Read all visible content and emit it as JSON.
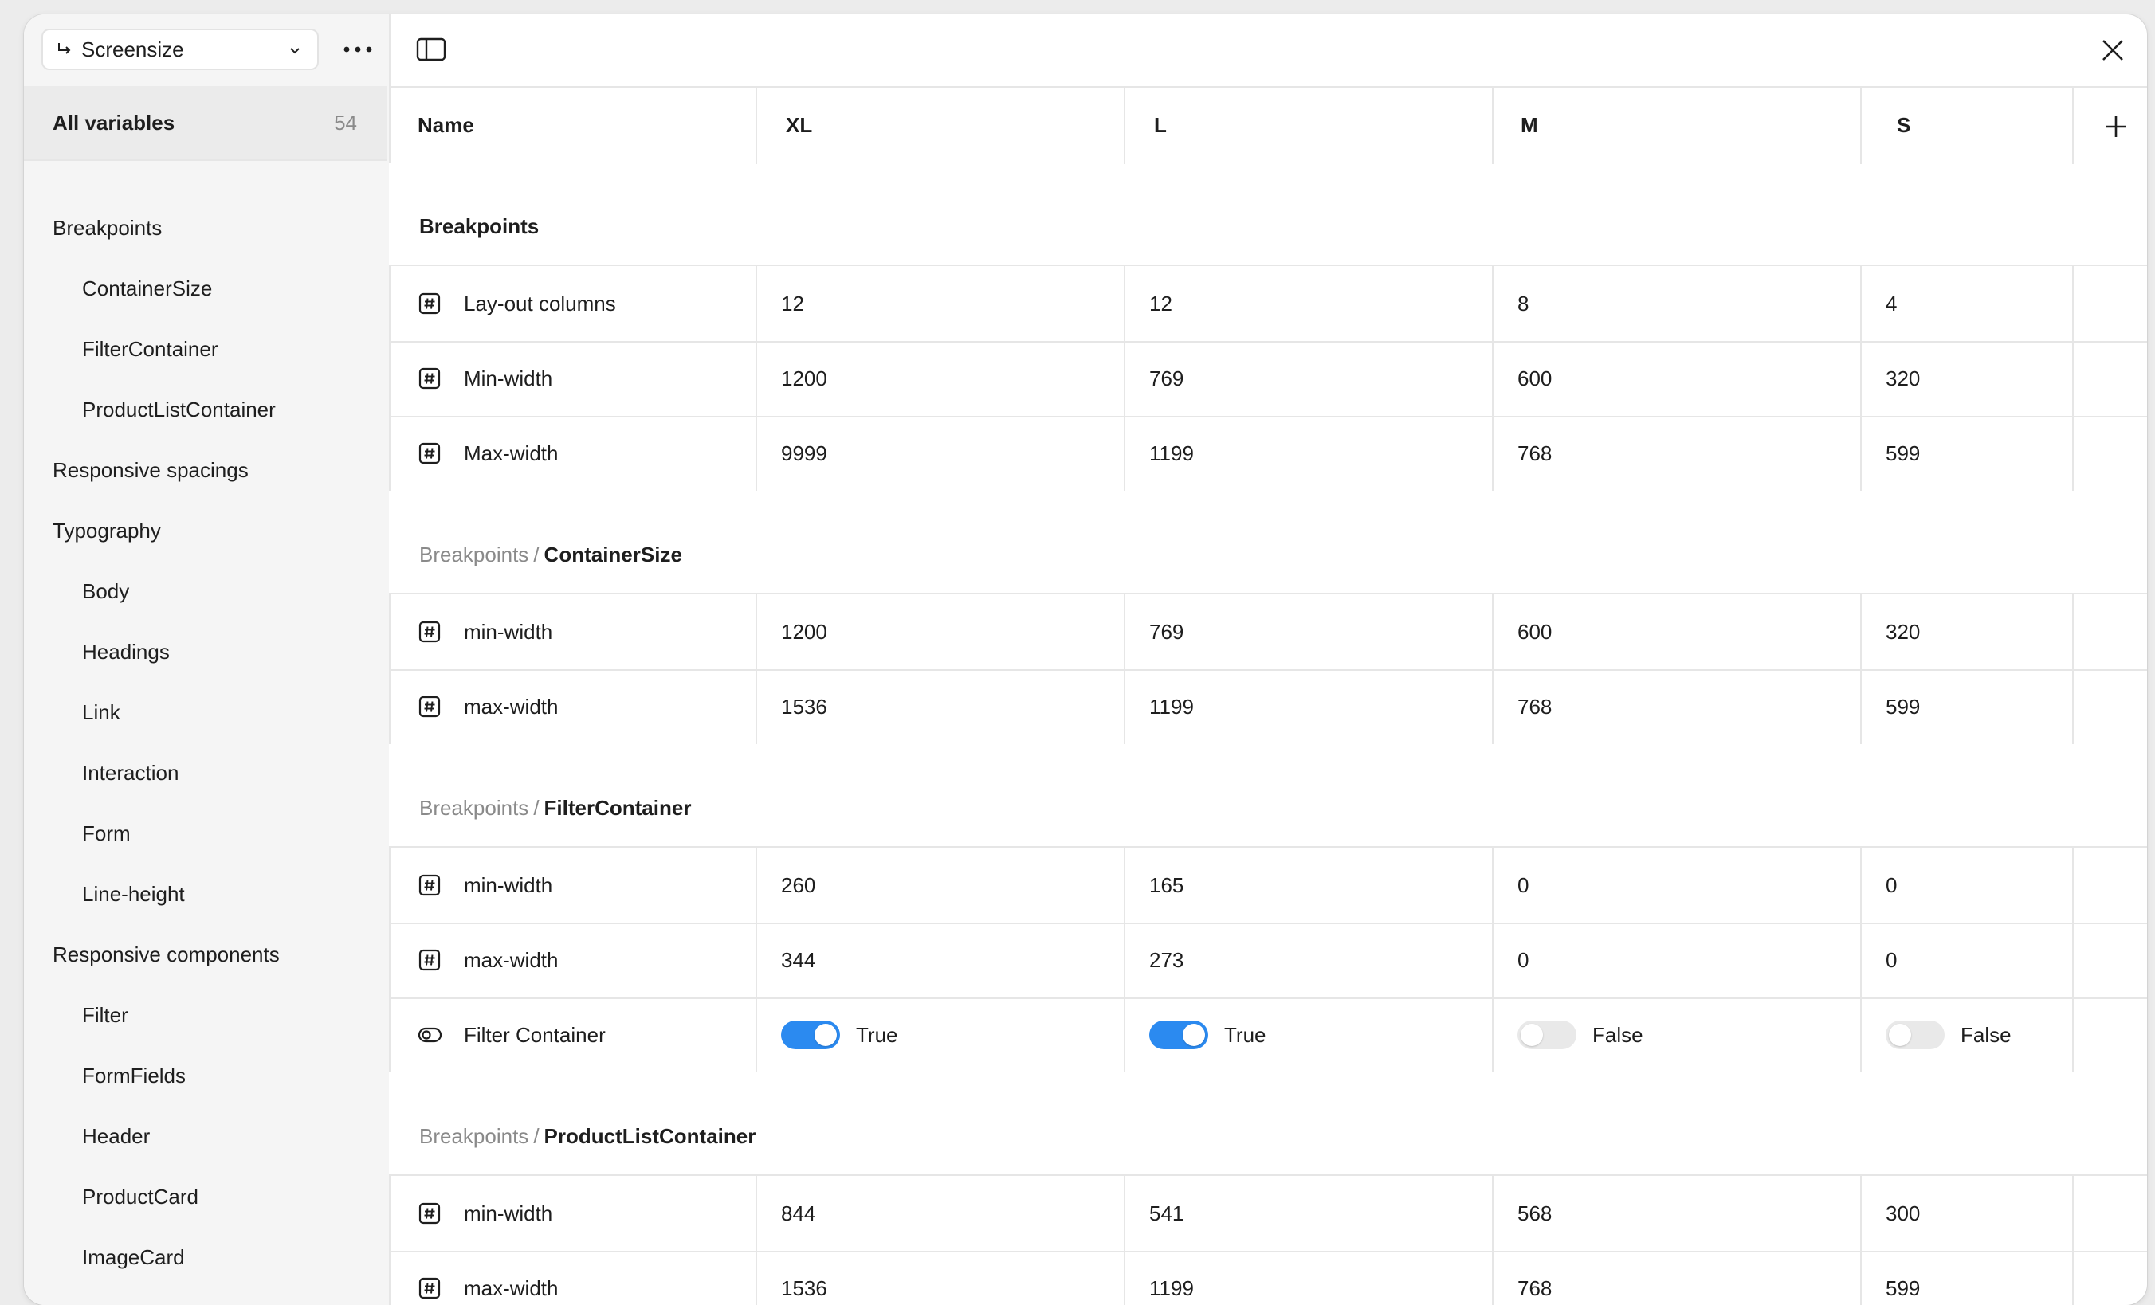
{
  "collection": {
    "name": "Screensize"
  },
  "sidebar": {
    "all_variables_label": "All variables",
    "all_variables_count": "54",
    "groups": [
      {
        "label": "Breakpoints",
        "level": 0
      },
      {
        "label": "ContainerSize",
        "level": 1
      },
      {
        "label": "FilterContainer",
        "level": 1
      },
      {
        "label": "ProductListContainer",
        "level": 1
      },
      {
        "label": "Responsive spacings",
        "level": 0
      },
      {
        "label": "Typography",
        "level": 0
      },
      {
        "label": "Body",
        "level": 1
      },
      {
        "label": "Headings",
        "level": 1
      },
      {
        "label": "Link",
        "level": 1
      },
      {
        "label": "Interaction",
        "level": 1
      },
      {
        "label": "Form",
        "level": 1
      },
      {
        "label": "Line-height",
        "level": 1
      },
      {
        "label": "Responsive components",
        "level": 0
      },
      {
        "label": "Filter",
        "level": 1
      },
      {
        "label": "FormFields",
        "level": 1
      },
      {
        "label": "Header",
        "level": 1
      },
      {
        "label": "ProductCard",
        "level": 1
      },
      {
        "label": "ImageCard",
        "level": 1
      }
    ]
  },
  "table": {
    "columns": [
      "Name",
      "XL",
      "L",
      "M",
      "S"
    ],
    "sections": [
      {
        "crumb": "",
        "leaf": "Breakpoints",
        "rows": [
          {
            "type": "number",
            "name": "Lay-out columns",
            "values": [
              "12",
              "12",
              "8",
              "4"
            ]
          },
          {
            "type": "number",
            "name": "Min-width",
            "values": [
              "1200",
              "769",
              "600",
              "320"
            ]
          },
          {
            "type": "number",
            "name": "Max-width",
            "values": [
              "9999",
              "1199",
              "768",
              "599"
            ]
          }
        ]
      },
      {
        "crumb": "Breakpoints",
        "leaf": "ContainerSize",
        "rows": [
          {
            "type": "number",
            "name": "min-width",
            "values": [
              "1200",
              "769",
              "600",
              "320"
            ]
          },
          {
            "type": "number",
            "name": "max-width",
            "values": [
              "1536",
              "1199",
              "768",
              "599"
            ]
          }
        ]
      },
      {
        "crumb": "Breakpoints",
        "leaf": "FilterContainer",
        "rows": [
          {
            "type": "number",
            "name": "min-width",
            "values": [
              "260",
              "165",
              "0",
              "0"
            ]
          },
          {
            "type": "number",
            "name": "max-width",
            "values": [
              "344",
              "273",
              "0",
              "0"
            ]
          },
          {
            "type": "boolean",
            "name": "Filter Container",
            "values": [
              "True",
              "True",
              "False",
              "False"
            ]
          }
        ]
      },
      {
        "crumb": "Breakpoints",
        "leaf": "ProductListContainer",
        "rows": [
          {
            "type": "number",
            "name": "min-width",
            "values": [
              "844",
              "541",
              "568",
              "300"
            ]
          },
          {
            "type": "number",
            "name": "max-width",
            "values": [
              "1536",
              "1199",
              "768",
              "599"
            ]
          }
        ]
      }
    ]
  },
  "colors": {
    "accent": "#2b8af0",
    "border": "#e6e6e6",
    "muted_text": "#8a8a8a",
    "sidebar_bg": "#f5f5f5"
  }
}
